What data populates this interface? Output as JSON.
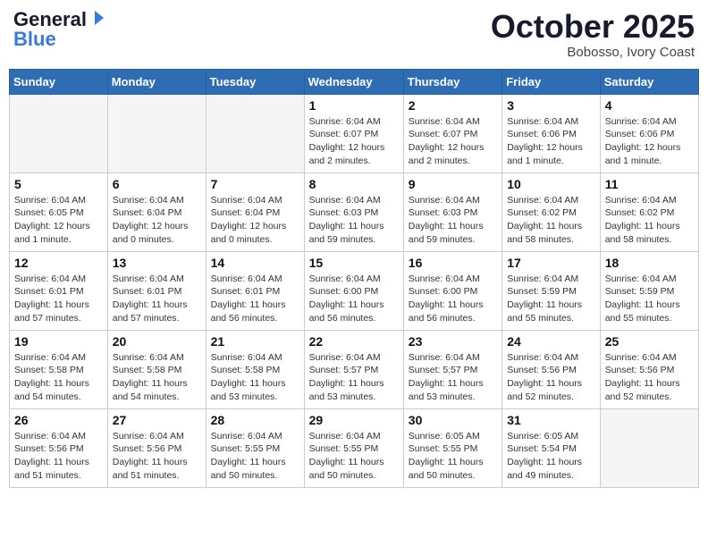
{
  "header": {
    "logo_line1": "General",
    "logo_line2": "Blue",
    "month": "October 2025",
    "location": "Bobosso, Ivory Coast"
  },
  "weekdays": [
    "Sunday",
    "Monday",
    "Tuesday",
    "Wednesday",
    "Thursday",
    "Friday",
    "Saturday"
  ],
  "weeks": [
    [
      {
        "day": "",
        "info": ""
      },
      {
        "day": "",
        "info": ""
      },
      {
        "day": "",
        "info": ""
      },
      {
        "day": "1",
        "info": "Sunrise: 6:04 AM\nSunset: 6:07 PM\nDaylight: 12 hours and 2 minutes."
      },
      {
        "day": "2",
        "info": "Sunrise: 6:04 AM\nSunset: 6:07 PM\nDaylight: 12 hours and 2 minutes."
      },
      {
        "day": "3",
        "info": "Sunrise: 6:04 AM\nSunset: 6:06 PM\nDaylight: 12 hours and 1 minute."
      },
      {
        "day": "4",
        "info": "Sunrise: 6:04 AM\nSunset: 6:06 PM\nDaylight: 12 hours and 1 minute."
      }
    ],
    [
      {
        "day": "5",
        "info": "Sunrise: 6:04 AM\nSunset: 6:05 PM\nDaylight: 12 hours and 1 minute."
      },
      {
        "day": "6",
        "info": "Sunrise: 6:04 AM\nSunset: 6:04 PM\nDaylight: 12 hours and 0 minutes."
      },
      {
        "day": "7",
        "info": "Sunrise: 6:04 AM\nSunset: 6:04 PM\nDaylight: 12 hours and 0 minutes."
      },
      {
        "day": "8",
        "info": "Sunrise: 6:04 AM\nSunset: 6:03 PM\nDaylight: 11 hours and 59 minutes."
      },
      {
        "day": "9",
        "info": "Sunrise: 6:04 AM\nSunset: 6:03 PM\nDaylight: 11 hours and 59 minutes."
      },
      {
        "day": "10",
        "info": "Sunrise: 6:04 AM\nSunset: 6:02 PM\nDaylight: 11 hours and 58 minutes."
      },
      {
        "day": "11",
        "info": "Sunrise: 6:04 AM\nSunset: 6:02 PM\nDaylight: 11 hours and 58 minutes."
      }
    ],
    [
      {
        "day": "12",
        "info": "Sunrise: 6:04 AM\nSunset: 6:01 PM\nDaylight: 11 hours and 57 minutes."
      },
      {
        "day": "13",
        "info": "Sunrise: 6:04 AM\nSunset: 6:01 PM\nDaylight: 11 hours and 57 minutes."
      },
      {
        "day": "14",
        "info": "Sunrise: 6:04 AM\nSunset: 6:01 PM\nDaylight: 11 hours and 56 minutes."
      },
      {
        "day": "15",
        "info": "Sunrise: 6:04 AM\nSunset: 6:00 PM\nDaylight: 11 hours and 56 minutes."
      },
      {
        "day": "16",
        "info": "Sunrise: 6:04 AM\nSunset: 6:00 PM\nDaylight: 11 hours and 56 minutes."
      },
      {
        "day": "17",
        "info": "Sunrise: 6:04 AM\nSunset: 5:59 PM\nDaylight: 11 hours and 55 minutes."
      },
      {
        "day": "18",
        "info": "Sunrise: 6:04 AM\nSunset: 5:59 PM\nDaylight: 11 hours and 55 minutes."
      }
    ],
    [
      {
        "day": "19",
        "info": "Sunrise: 6:04 AM\nSunset: 5:58 PM\nDaylight: 11 hours and 54 minutes."
      },
      {
        "day": "20",
        "info": "Sunrise: 6:04 AM\nSunset: 5:58 PM\nDaylight: 11 hours and 54 minutes."
      },
      {
        "day": "21",
        "info": "Sunrise: 6:04 AM\nSunset: 5:58 PM\nDaylight: 11 hours and 53 minutes."
      },
      {
        "day": "22",
        "info": "Sunrise: 6:04 AM\nSunset: 5:57 PM\nDaylight: 11 hours and 53 minutes."
      },
      {
        "day": "23",
        "info": "Sunrise: 6:04 AM\nSunset: 5:57 PM\nDaylight: 11 hours and 53 minutes."
      },
      {
        "day": "24",
        "info": "Sunrise: 6:04 AM\nSunset: 5:56 PM\nDaylight: 11 hours and 52 minutes."
      },
      {
        "day": "25",
        "info": "Sunrise: 6:04 AM\nSunset: 5:56 PM\nDaylight: 11 hours and 52 minutes."
      }
    ],
    [
      {
        "day": "26",
        "info": "Sunrise: 6:04 AM\nSunset: 5:56 PM\nDaylight: 11 hours and 51 minutes."
      },
      {
        "day": "27",
        "info": "Sunrise: 6:04 AM\nSunset: 5:56 PM\nDaylight: 11 hours and 51 minutes."
      },
      {
        "day": "28",
        "info": "Sunrise: 6:04 AM\nSunset: 5:55 PM\nDaylight: 11 hours and 50 minutes."
      },
      {
        "day": "29",
        "info": "Sunrise: 6:04 AM\nSunset: 5:55 PM\nDaylight: 11 hours and 50 minutes."
      },
      {
        "day": "30",
        "info": "Sunrise: 6:05 AM\nSunset: 5:55 PM\nDaylight: 11 hours and 50 minutes."
      },
      {
        "day": "31",
        "info": "Sunrise: 6:05 AM\nSunset: 5:54 PM\nDaylight: 11 hours and 49 minutes."
      },
      {
        "day": "",
        "info": ""
      }
    ]
  ]
}
